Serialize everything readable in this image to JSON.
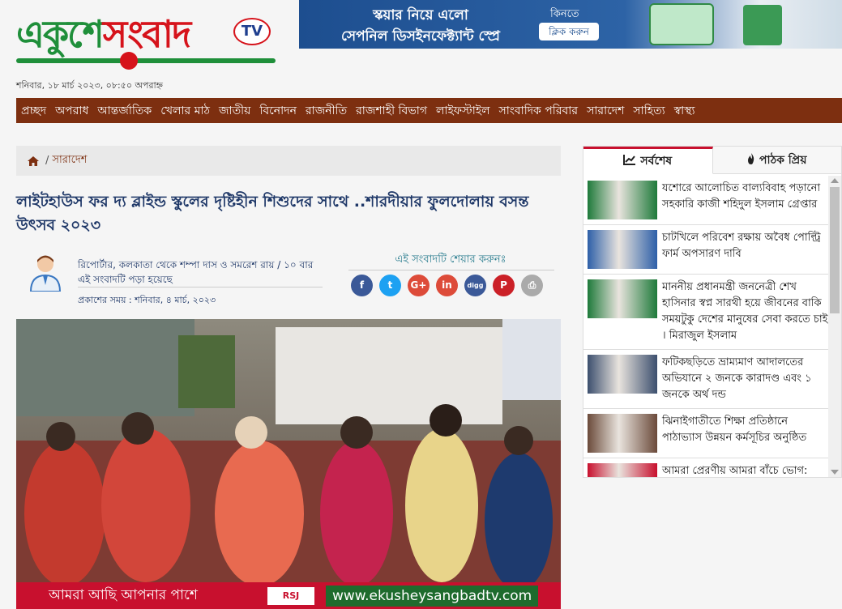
{
  "logo": {
    "part1": "একুশে",
    "part2": "সংবাদ",
    "tv": "TV"
  },
  "ad_top": {
    "line1": "স্কয়ার নিয়ে এলো",
    "line2": "সেপনিল ডিসইনফেক্ট্যান্ট স্প্রে",
    "buy_label": "কিনতে",
    "click_label": "ক্লিক করুন"
  },
  "dateline": "শনিবার, ১৮ মার্চ ২০২৩, ০৮:৫০ অপরাহ্ন",
  "nav": [
    "প্রচ্ছদ",
    "অপরাধ",
    "আন্তর্জাতিক",
    "খেলার মাঠ",
    "জাতীয়",
    "বিনোদন",
    "রাজনীতি",
    "রাজশাহী বিভাগ",
    "লাইফস্টাইল",
    "সাংবাদিক পরিবার",
    "সারাদেশ",
    "সাহিত্য",
    "স্বাস্থ্য"
  ],
  "breadcrumb": {
    "sep": "/",
    "section": "সারাদেশ"
  },
  "article": {
    "headline": "লাইটহাউস ফর দ্য ব্লাইন্ড স্কুলের দৃষ্টিহীন শিশুদের সাথে ..শারদীয়ার ফুলদোলায় বসন্ত উৎসব ২০২৩",
    "reporter": "রিপোর্টার, কলকাতা থেকে শম্পা দাস ও সমরেশ রায় / ১০ বার এই সংবাদটি পড়া হয়েছে",
    "published": "প্রকাশের সময় : শনিবার, ৪ মার্চ, ২০২৩",
    "share_label": "এই সংবাদটি শেয়ার করুনঃ"
  },
  "share_buttons": [
    {
      "icon": "facebook-icon",
      "glyph": "f",
      "color": "#3b5998"
    },
    {
      "icon": "twitter-icon",
      "glyph": "t",
      "color": "#1da1f2"
    },
    {
      "icon": "google-plus-icon",
      "glyph": "G+",
      "color": "#dd4b39"
    },
    {
      "icon": "linkedin-icon",
      "glyph": "in",
      "color": "#dd4b39"
    },
    {
      "icon": "digg-icon",
      "glyph": "digg",
      "color": "#3b5998"
    },
    {
      "icon": "pinterest-icon",
      "glyph": "P",
      "color": "#cb2027"
    },
    {
      "icon": "print-icon",
      "glyph": "⎙",
      "color": "#aaaaaa"
    }
  ],
  "photo_banner": {
    "tagline": "আমরা আছি আপনার পাশে",
    "logo": "RSJ",
    "url": "www.ekusheysangbadtv.com"
  },
  "sidebar": {
    "tabs": [
      {
        "label": "সর্বশেষ",
        "icon": "chart-icon"
      },
      {
        "label": "পাঠক প্রিয়",
        "icon": "fire-icon"
      }
    ],
    "news": [
      {
        "title": "যশোরে আলোচিত বাল্যবিবাহ পড়ানো সহকারি কাজী শহিদুল ইসলাম গ্রেপ্তার",
        "thumb_color": "#1e7a3a"
      },
      {
        "title": "চাটখিলে পরিবেশ রক্ষায় অবৈধ পোল্ট্রি ফার্ম অপসারণ দাবি",
        "thumb_color": "#2d5fa8"
      },
      {
        "title": "মাননীয় প্রধানমন্ত্রী জননেত্রী শেখ হাসিনার স্বপ্ন সারথী হয়ে জীবনের বাকি সময়টুকু দেশের মানুষের সেবা করতে চাই । মিরাজুল ইসলাম",
        "thumb_color": "#1e7a3a"
      },
      {
        "title": "ফটিকছড়িতে ভ্রাম্যমাণ আদালতের অভিযানে ২ জনকে কারাদণ্ড এবং ১ জনকে অর্থ দন্ড",
        "thumb_color": "#3c4f6e"
      },
      {
        "title": "ঝিনাইগাতীতে শিক্ষা প্রতিষ্ঠানে পাঠাভ্যাস উন্নয়ন কর্মসূচির অনুষ্ঠিত",
        "thumb_color": "#6b4a3a"
      },
      {
        "title": "আমরা প্রেরণীয় আমরা বাঁচে ভোগ: বাচ্চাই",
        "thumb_color": "#c8102e"
      }
    ]
  }
}
